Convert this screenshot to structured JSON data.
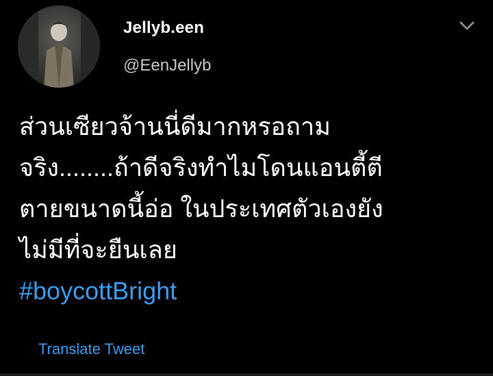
{
  "tweet": {
    "display_name": "Jellyb.een",
    "handle": "@EenJellyb",
    "text_lines": [
      "ส่วนเซียวจ้านนี่ดีมากหรอถาม",
      "จริง........ถ้าดีจริงทำไมโดนแอนตี้ตี",
      "ตายขนาดนี้อ่อ ในประเทศตัวเองยัง",
      "ไม่มีที่จะยืนเลย"
    ],
    "hashtag": "#boycottBright",
    "translate_label": "Translate Tweet"
  },
  "icons": {
    "menu": "chevron-down-icon",
    "avatar": "profile-photo"
  },
  "colors": {
    "background": "#000000",
    "text": "#ffffff",
    "secondary_text": "#c9c9c9",
    "link": "#3d9df0"
  }
}
